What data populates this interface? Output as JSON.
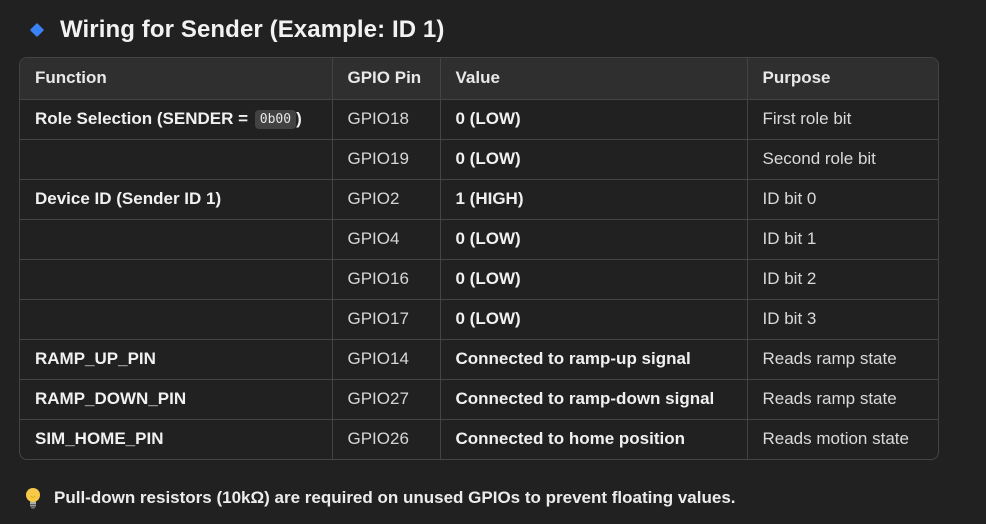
{
  "heading": {
    "icon": "diamond-bullet-icon",
    "icon_color": "#3b82f6",
    "title": "Wiring for Sender (Example: ID 1)"
  },
  "table": {
    "headers": [
      "Function",
      "GPIO Pin",
      "Value",
      "Purpose"
    ],
    "rows": [
      {
        "function": "Role Selection (SENDER = ",
        "code": "0b00",
        "function_suffix": ")",
        "pin": "GPIO18",
        "value": "0 (LOW)",
        "purpose": "First role bit"
      },
      {
        "function": "",
        "pin": "GPIO19",
        "value": "0 (LOW)",
        "purpose": "Second role bit"
      },
      {
        "function": "Device ID (Sender ID 1)",
        "pin": "GPIO2",
        "value": "1 (HIGH)",
        "purpose": "ID bit 0"
      },
      {
        "function": "",
        "pin": "GPIO4",
        "value": "0 (LOW)",
        "purpose": "ID bit 1"
      },
      {
        "function": "",
        "pin": "GPIO16",
        "value": "0 (LOW)",
        "purpose": "ID bit 2"
      },
      {
        "function": "",
        "pin": "GPIO17",
        "value": "0 (LOW)",
        "purpose": "ID bit 3"
      },
      {
        "function": "RAMP_UP_PIN",
        "pin": "GPIO14",
        "value": "Connected to ramp-up signal",
        "purpose": "Reads ramp state"
      },
      {
        "function": "RAMP_DOWN_PIN",
        "pin": "GPIO27",
        "value": "Connected to ramp-down signal",
        "purpose": "Reads ramp state"
      },
      {
        "function": "SIM_HOME_PIN",
        "pin": "GPIO26",
        "value": "Connected to home position",
        "purpose": "Reads motion state"
      }
    ]
  },
  "footnote": {
    "icon": "lightbulb-icon",
    "text": "Pull-down resistors (10kΩ) are required on unused GPIOs to prevent floating values."
  }
}
